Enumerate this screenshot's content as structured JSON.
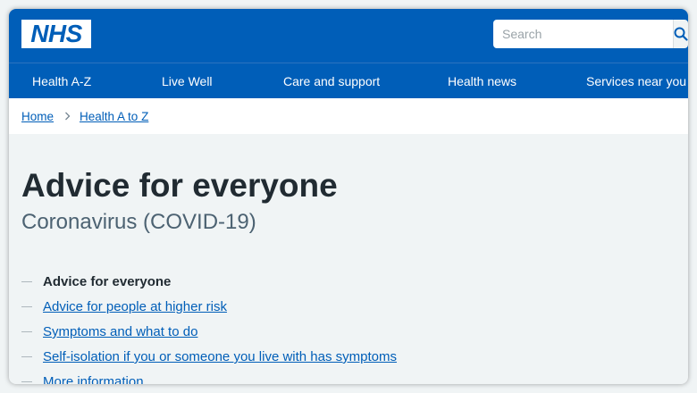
{
  "header": {
    "logo_text": "NHS",
    "search_placeholder": "Search"
  },
  "nav": {
    "items": [
      {
        "label": "Health A-Z"
      },
      {
        "label": "Live Well"
      },
      {
        "label": "Care and support"
      },
      {
        "label": "Health news"
      },
      {
        "label": "Services near you"
      }
    ]
  },
  "breadcrumb": {
    "items": [
      {
        "label": "Home"
      },
      {
        "label": "Health A to Z"
      }
    ]
  },
  "main": {
    "title": "Advice for everyone",
    "subtitle": "Coronavirus (COVID-19)",
    "contents": [
      {
        "label": "Advice for everyone",
        "current": true
      },
      {
        "label": "Advice for people at higher risk",
        "current": false
      },
      {
        "label": "Symptoms and what to do",
        "current": false
      },
      {
        "label": "Self-isolation if you or someone you live with has symptoms",
        "current": false
      },
      {
        "label": "More information",
        "current": false
      }
    ]
  },
  "colors": {
    "brand_blue": "#005eb8",
    "page_background": "#f0f4f5",
    "text_dark": "#212b32",
    "text_secondary": "#4c6272"
  },
  "icons": {
    "search": "search-icon",
    "breadcrumb_separator": "chevron-right-icon"
  }
}
